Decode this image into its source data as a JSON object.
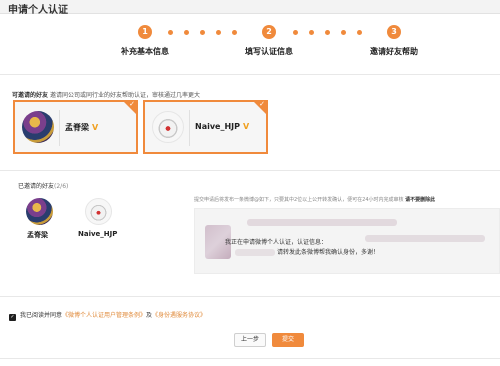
{
  "header": {
    "title": "申请个人认证"
  },
  "steps": [
    {
      "num": "1",
      "label": "补充基本信息"
    },
    {
      "num": "2",
      "label": "填写认证信息"
    },
    {
      "num": "3",
      "label": "邀请好友帮助"
    }
  ],
  "tip": {
    "label": "可邀请的好友",
    "text": "邀请同公司或同行业的好友帮助认证，审核通过几率更大"
  },
  "cards": [
    {
      "name": "孟脊梁",
      "badge": "V",
      "selected": true
    },
    {
      "name": "Naive_HJP",
      "badge": "V",
      "selected": true
    }
  ],
  "invited": {
    "title": "已邀请的好友",
    "count": "(2/6)",
    "friends": [
      "孟脊梁",
      "Naive_HJP"
    ]
  },
  "notice": {
    "text": "提交申请后将发布一条微博@如下，只要其中2位以上公开转发确认，便可在24小时内完成审核",
    "link": "请不要删除此"
  },
  "share": {
    "line1": "我正在申请微博个人认证，认证信息：",
    "line2": "请转发此条微博帮我确认身份，多谢！"
  },
  "agreement": {
    "checked": true,
    "prefix": "我已阅读并同意",
    "link1": "《微博个人认证用户管理条例》",
    "middle": "及",
    "link2": "《身份遇服务协议》"
  },
  "buttons": {
    "prev": "上一步",
    "submit": "提交"
  },
  "colors": {
    "accent": "#f08a3c",
    "badge": "#f0a020",
    "link": "#e08a3a"
  }
}
